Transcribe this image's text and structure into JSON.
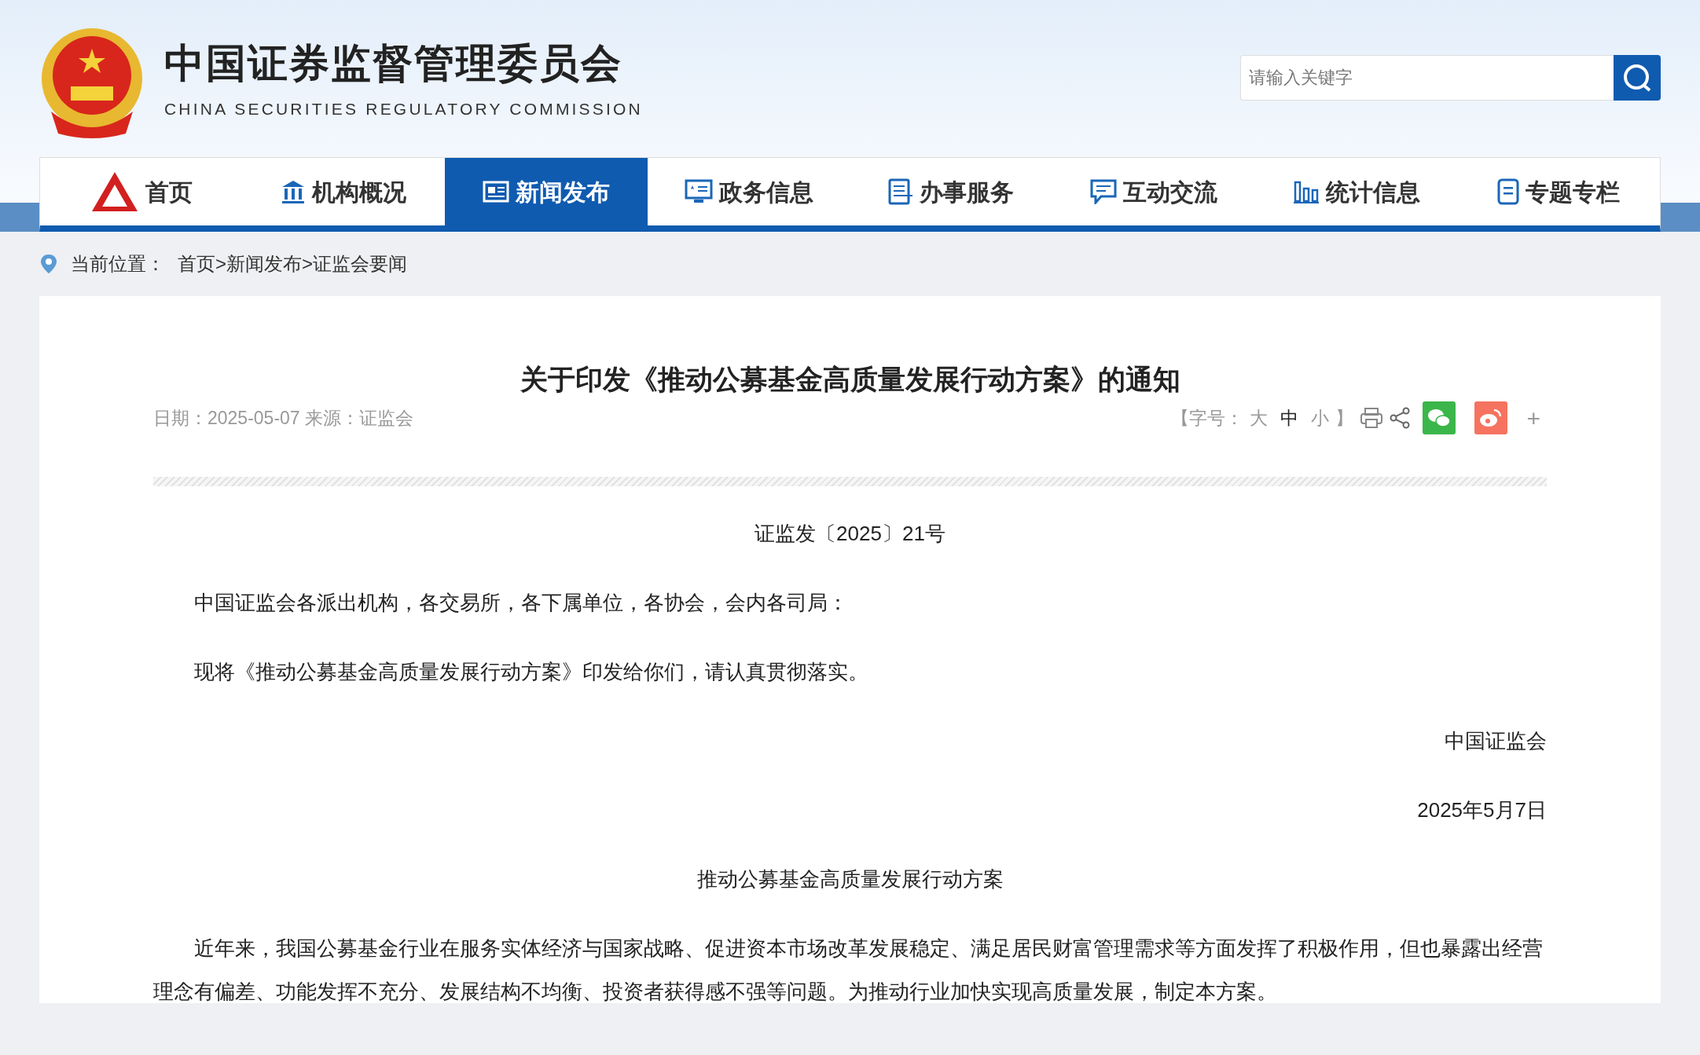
{
  "header": {
    "title": "中国证券监督管理委员会",
    "subtitle": "CHINA SECURITIES REGULATORY COMMISSION",
    "search": {
      "placeholder": "请输入关键字"
    }
  },
  "nav": {
    "items": [
      {
        "label": "首页",
        "selected": false
      },
      {
        "label": "机构概况",
        "selected": false
      },
      {
        "label": "新闻发布",
        "selected": true
      },
      {
        "label": "政务信息",
        "selected": false
      },
      {
        "label": "办事服务",
        "selected": false
      },
      {
        "label": "互动交流",
        "selected": false
      },
      {
        "label": "统计信息",
        "selected": false
      },
      {
        "label": "专题专栏",
        "selected": false
      }
    ]
  },
  "breadcrumb": {
    "label": "当前位置：",
    "crumbs": [
      "首页",
      "新闻发布",
      "证监会要闻"
    ],
    "separators": [
      ">",
      ">"
    ]
  },
  "article": {
    "title": "关于印发《推动公募基金高质量发展行动方案》的通知",
    "meta": "日期：2025-05-07 来源：证监会",
    "font_size": {
      "open": "【字号：",
      "options": [
        {
          "label": "大",
          "selected": false
        },
        {
          "label": "中",
          "selected": true
        },
        {
          "label": "小",
          "selected": false
        }
      ],
      "close": "】"
    },
    "share": [
      {
        "kind": "print"
      },
      {
        "kind": "share"
      },
      {
        "kind": "wechat"
      },
      {
        "kind": "weibo"
      },
      {
        "kind": "more",
        "label": "+"
      }
    ],
    "paragraphs": [
      {
        "kind": "center",
        "text": "证监发〔2025〕21号"
      },
      {
        "kind": "indent",
        "text": "中国证监会各派出机构，各交易所，各下属单位，各协会，会内各司局："
      },
      {
        "kind": "indent",
        "text": "现将《推动公募基金高质量发展行动方案》印发给你们，请认真贯彻落实。"
      },
      {
        "kind": "right",
        "text": "中国证监会"
      },
      {
        "kind": "right",
        "text": "2025年5月7日"
      },
      {
        "kind": "center",
        "text": "推动公募基金高质量发展行动方案"
      },
      {
        "kind": "indent",
        "text": "近年来，我国公募基金行业在服务实体经济与国家战略、促进资本市场改革发展稳定、满足居民财富管理需求等方面发挥了积极作用，但也暴露出经营理念有偏差、功能发挥不充分、发展结构不均衡、投资者获得感不强等问题。为推动行业加快实现高质量发展，制定本方案。"
      }
    ]
  }
}
